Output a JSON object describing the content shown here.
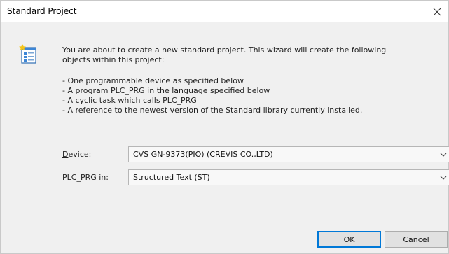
{
  "window": {
    "title": "Standard Project",
    "close_glyph": "×"
  },
  "message": {
    "intro_line1": "You are about to create a new standard project. This wizard will create the following",
    "intro_line2": "objects within this project:",
    "items": [
      "- One programmable device as specified below",
      "- A program PLC_PRG in the language specified below",
      "- A cyclic task which calls PLC_PRG",
      "- A reference to the newest version of the Standard library currently installed."
    ]
  },
  "device": {
    "label_mnemonic": "D",
    "label_rest": "evice:",
    "value": "CVS GN-9373(PIO) (CREVIS CO.,LTD)"
  },
  "plc_prg": {
    "label_mnemonic": "P",
    "label_rest": "LC_PRG in:",
    "value": "Structured Text (ST)"
  },
  "buttons": {
    "ok": "OK",
    "cancel": "Cancel"
  },
  "icons": {
    "wizard": "new-project-wizard-icon",
    "close": "close-icon",
    "dropdown": "chevron-down-icon"
  },
  "colors": {
    "dialog_bg": "#f0f0f0",
    "titlebar_bg": "#ffffff",
    "default_button_border": "#0078d7"
  }
}
